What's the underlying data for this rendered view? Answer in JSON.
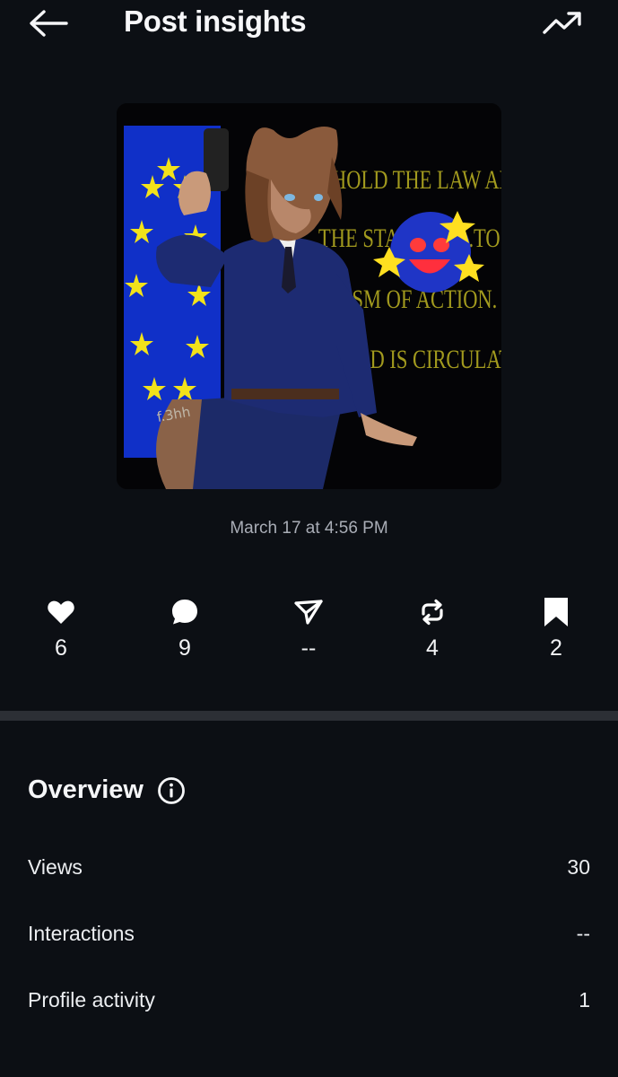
{
  "header": {
    "title": "Post insights"
  },
  "artwork": {
    "sign_lines": [
      "HOLD THE LAW AND",
      "THE STATE, LA...TO",
      "ISM OF ACTION.",
      "OD IS CIRCULATION"
    ],
    "signature": "f.3hh"
  },
  "post": {
    "timestamp": "March 17 at 4:56 PM"
  },
  "stats": [
    {
      "icon": "heart-icon",
      "value": "6"
    },
    {
      "icon": "comment-icon",
      "value": "9"
    },
    {
      "icon": "share-icon",
      "value": "--"
    },
    {
      "icon": "repost-icon",
      "value": "4"
    },
    {
      "icon": "bookmark-icon",
      "value": "2"
    }
  ],
  "overview": {
    "title": "Overview",
    "rows": [
      {
        "label": "Views",
        "value": "30"
      },
      {
        "label": "Interactions",
        "value": "--"
      },
      {
        "label": "Profile activity",
        "value": "1"
      }
    ]
  },
  "colors": {
    "background": "#0c0f14",
    "divider": "#2c2f35",
    "muted_text": "#a9adb6"
  }
}
